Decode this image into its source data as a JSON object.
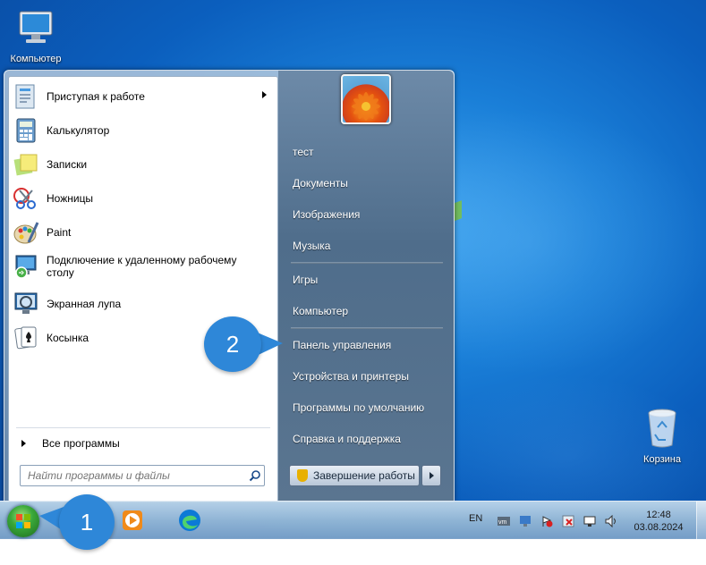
{
  "desktop": {
    "icons": [
      {
        "label": "Компьютер"
      },
      {
        "label": "Корзина"
      }
    ]
  },
  "start_menu": {
    "programs": [
      {
        "label": "Приступая к работе",
        "icon": "getting-started-icon",
        "has_submenu": true
      },
      {
        "label": "Калькулятор",
        "icon": "calculator-icon"
      },
      {
        "label": "Записки",
        "icon": "sticky-notes-icon"
      },
      {
        "label": "Ножницы",
        "icon": "snipping-tool-icon"
      },
      {
        "label": "Paint",
        "icon": "paint-icon"
      },
      {
        "label": "Подключение к удаленному рабочему столу",
        "icon": "remote-desktop-icon"
      },
      {
        "label": "Экранная лупа",
        "icon": "magnifier-icon"
      },
      {
        "label": "Косынка",
        "icon": "solitaire-icon"
      }
    ],
    "all_programs_label": "Все программы",
    "search_placeholder": "Найти программы и файлы",
    "right_links": [
      {
        "label": "тест"
      },
      {
        "label": "Документы"
      },
      {
        "label": "Изображения"
      },
      {
        "label": "Музыка"
      },
      {
        "label": "Игры"
      },
      {
        "label": "Компьютер"
      },
      {
        "label": "Панель управления"
      },
      {
        "label": "Устройства и принтеры"
      },
      {
        "label": "Программы по умолчанию"
      },
      {
        "label": "Справка и поддержка"
      }
    ],
    "shutdown_label": "Завершение работы"
  },
  "taskbar": {
    "apps": [
      "media-player-icon",
      "edge-icon"
    ],
    "language": "EN",
    "time": "12:48",
    "date": "03.08.2024"
  },
  "callouts": [
    {
      "number": "1",
      "color": "#2e87d8"
    },
    {
      "number": "2",
      "color": "#2e87d8"
    }
  ]
}
